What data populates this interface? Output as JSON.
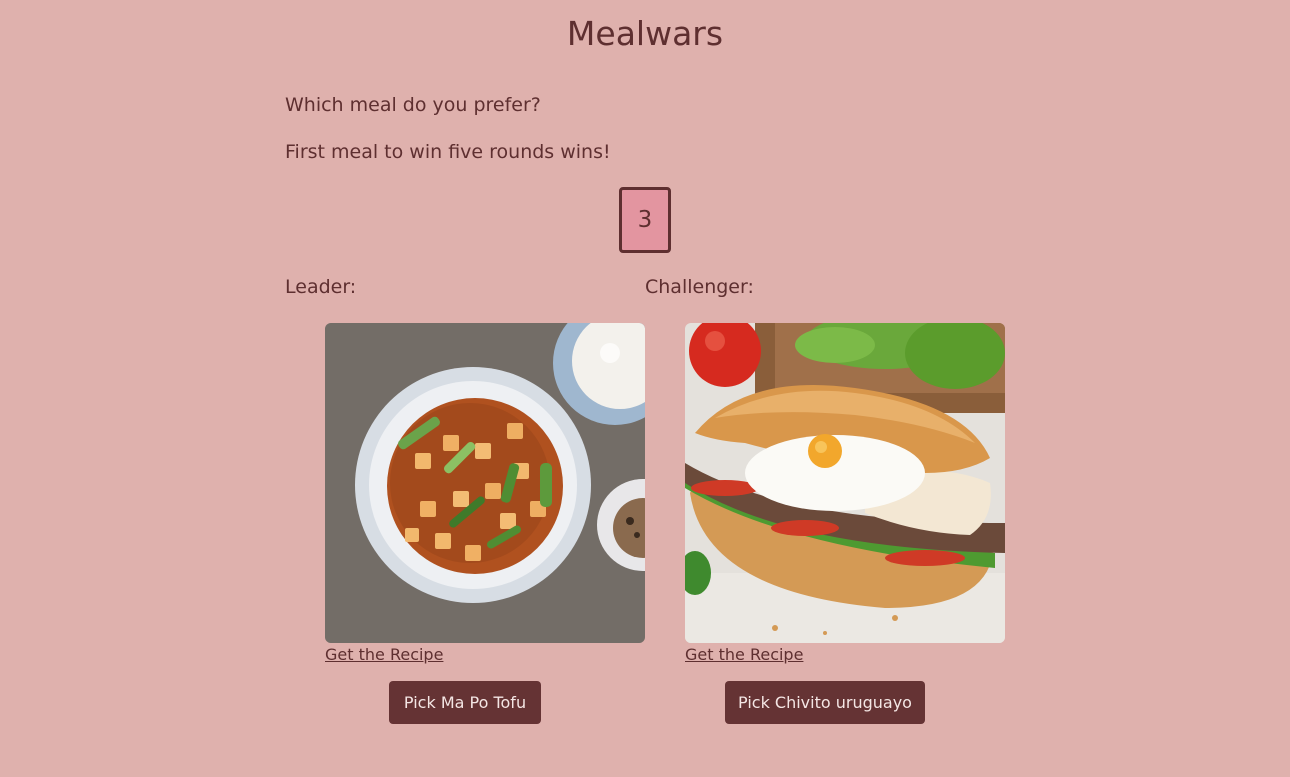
{
  "app": {
    "title": "Mealwars"
  },
  "intro": {
    "question": "Which meal do you prefer?",
    "rule": "First meal to win five rounds wins!"
  },
  "round": {
    "number": "3"
  },
  "leader": {
    "label": "Leader:",
    "meal_name": "Ma Po Tofu",
    "image_icon": "ma-po-tofu-photo",
    "recipe_link": "Get the Recipe",
    "pick_button": "Pick Ma Po Tofu"
  },
  "challenger": {
    "label": "Challenger:",
    "meal_name": "Chivito uruguayo",
    "image_icon": "chivito-sandwich-photo",
    "recipe_link": "Get the Recipe",
    "pick_button": "Pick Chivito uruguayo"
  },
  "colors": {
    "background": "#dfb1ad",
    "text": "#5e2f30",
    "button": "#653334",
    "round_box": "#e395a0"
  }
}
